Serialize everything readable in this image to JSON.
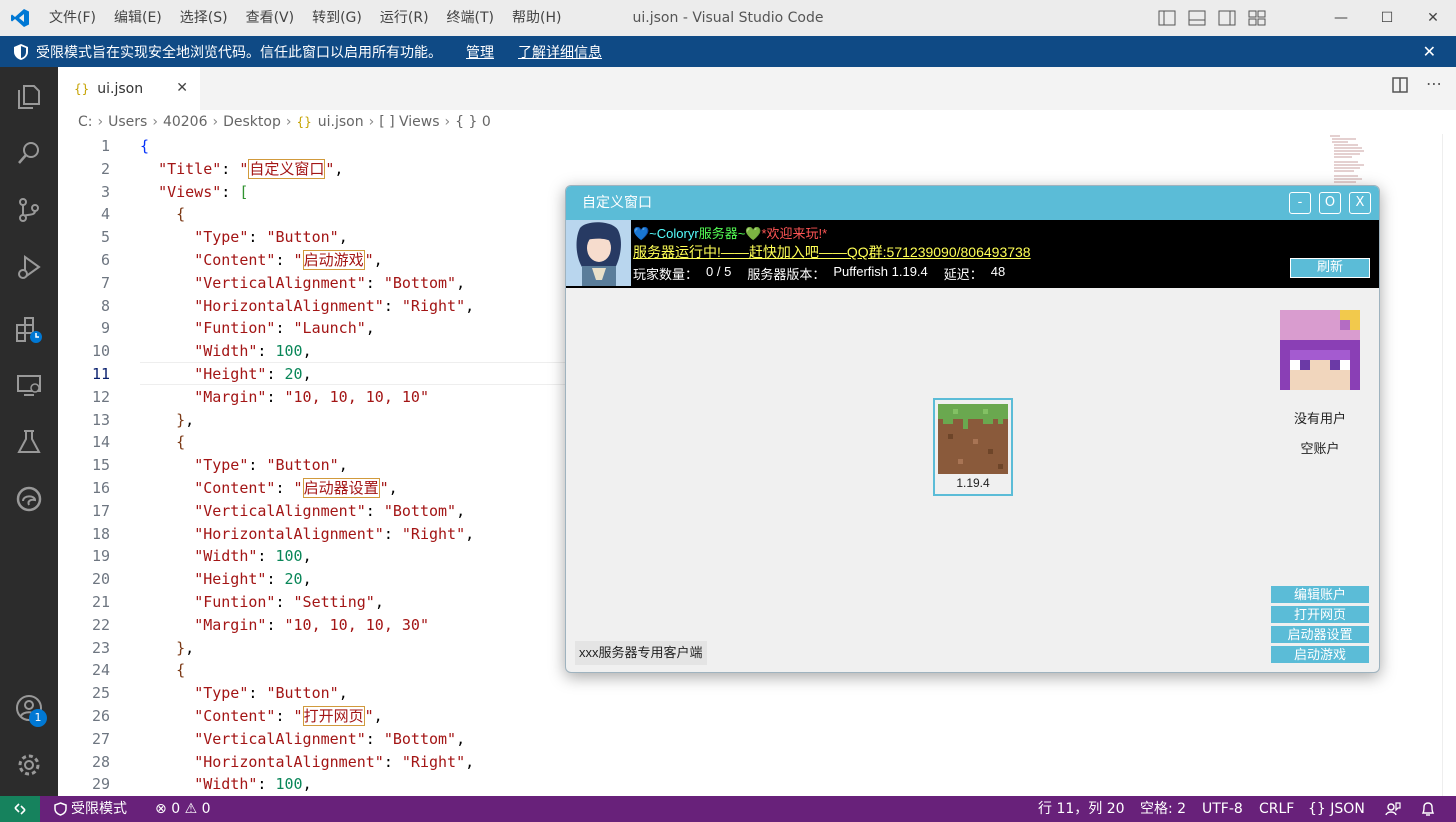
{
  "window": {
    "title": "ui.json - Visual Studio Code",
    "menu": [
      "文件(F)",
      "编辑(E)",
      "选择(S)",
      "查看(V)",
      "转到(G)",
      "运行(R)",
      "终端(T)",
      "帮助(H)"
    ]
  },
  "banner": {
    "text": "受限模式旨在实现安全地浏览代码。信任此窗口以启用所有功能。",
    "manage": "管理",
    "learn_more": "了解详细信息"
  },
  "activity": {
    "accounts_badge": "1"
  },
  "tab": {
    "label": "ui.json",
    "icon": "{}"
  },
  "breadcrumb": [
    "C:",
    "Users",
    "40206",
    "Desktop",
    "ui.json",
    "[ ] Views",
    "{ } 0"
  ],
  "editor": {
    "current_line": 11,
    "lines": [
      [
        {
          "t": "{",
          "c": "b1"
        }
      ],
      [
        {
          "t": "  "
        },
        {
          "t": "\"Title\"",
          "c": "k"
        },
        {
          "t": ": ",
          "c": "p"
        },
        {
          "t": "\"",
          "c": "s"
        },
        {
          "t": "自定义窗口",
          "c": "s hl"
        },
        {
          "t": "\"",
          "c": "s"
        },
        {
          "t": ",",
          "c": "p"
        }
      ],
      [
        {
          "t": "  "
        },
        {
          "t": "\"Views\"",
          "c": "k"
        },
        {
          "t": ": ",
          "c": "p"
        },
        {
          "t": "[",
          "c": "b2"
        }
      ],
      [
        {
          "t": "    "
        },
        {
          "t": "{",
          "c": "b3"
        }
      ],
      [
        {
          "t": "      "
        },
        {
          "t": "\"Type\"",
          "c": "k"
        },
        {
          "t": ": ",
          "c": "p"
        },
        {
          "t": "\"Button\"",
          "c": "s"
        },
        {
          "t": ",",
          "c": "p"
        }
      ],
      [
        {
          "t": "      "
        },
        {
          "t": "\"Content\"",
          "c": "k"
        },
        {
          "t": ": ",
          "c": "p"
        },
        {
          "t": "\"",
          "c": "s"
        },
        {
          "t": "启动游戏",
          "c": "s hl"
        },
        {
          "t": "\"",
          "c": "s"
        },
        {
          "t": ",",
          "c": "p"
        }
      ],
      [
        {
          "t": "      "
        },
        {
          "t": "\"VerticalAlignment\"",
          "c": "k"
        },
        {
          "t": ": ",
          "c": "p"
        },
        {
          "t": "\"Bottom\"",
          "c": "s"
        },
        {
          "t": ",",
          "c": "p"
        }
      ],
      [
        {
          "t": "      "
        },
        {
          "t": "\"HorizontalAlignment\"",
          "c": "k"
        },
        {
          "t": ": ",
          "c": "p"
        },
        {
          "t": "\"Right\"",
          "c": "s"
        },
        {
          "t": ",",
          "c": "p"
        }
      ],
      [
        {
          "t": "      "
        },
        {
          "t": "\"Funtion\"",
          "c": "k"
        },
        {
          "t": ": ",
          "c": "p"
        },
        {
          "t": "\"Launch\"",
          "c": "s"
        },
        {
          "t": ",",
          "c": "p"
        }
      ],
      [
        {
          "t": "      "
        },
        {
          "t": "\"Width\"",
          "c": "k"
        },
        {
          "t": ": ",
          "c": "p"
        },
        {
          "t": "100",
          "c": "n"
        },
        {
          "t": ",",
          "c": "p"
        }
      ],
      [
        {
          "t": "      "
        },
        {
          "t": "\"Height\"",
          "c": "k"
        },
        {
          "t": ": ",
          "c": "p"
        },
        {
          "t": "20",
          "c": "n"
        },
        {
          "t": ",",
          "c": "p"
        }
      ],
      [
        {
          "t": "      "
        },
        {
          "t": "\"Margin\"",
          "c": "k"
        },
        {
          "t": ": ",
          "c": "p"
        },
        {
          "t": "\"10, 10, 10, 10\"",
          "c": "s"
        }
      ],
      [
        {
          "t": "    "
        },
        {
          "t": "}",
          "c": "b3"
        },
        {
          "t": ",",
          "c": "p"
        }
      ],
      [
        {
          "t": "    "
        },
        {
          "t": "{",
          "c": "b3"
        }
      ],
      [
        {
          "t": "      "
        },
        {
          "t": "\"Type\"",
          "c": "k"
        },
        {
          "t": ": ",
          "c": "p"
        },
        {
          "t": "\"Button\"",
          "c": "s"
        },
        {
          "t": ",",
          "c": "p"
        }
      ],
      [
        {
          "t": "      "
        },
        {
          "t": "\"Content\"",
          "c": "k"
        },
        {
          "t": ": ",
          "c": "p"
        },
        {
          "t": "\"",
          "c": "s"
        },
        {
          "t": "启动器设置",
          "c": "s hl"
        },
        {
          "t": "\"",
          "c": "s"
        },
        {
          "t": ",",
          "c": "p"
        }
      ],
      [
        {
          "t": "      "
        },
        {
          "t": "\"VerticalAlignment\"",
          "c": "k"
        },
        {
          "t": ": ",
          "c": "p"
        },
        {
          "t": "\"Bottom\"",
          "c": "s"
        },
        {
          "t": ",",
          "c": "p"
        }
      ],
      [
        {
          "t": "      "
        },
        {
          "t": "\"HorizontalAlignment\"",
          "c": "k"
        },
        {
          "t": ": ",
          "c": "p"
        },
        {
          "t": "\"Right\"",
          "c": "s"
        },
        {
          "t": ",",
          "c": "p"
        }
      ],
      [
        {
          "t": "      "
        },
        {
          "t": "\"Width\"",
          "c": "k"
        },
        {
          "t": ": ",
          "c": "p"
        },
        {
          "t": "100",
          "c": "n"
        },
        {
          "t": ",",
          "c": "p"
        }
      ],
      [
        {
          "t": "      "
        },
        {
          "t": "\"Height\"",
          "c": "k"
        },
        {
          "t": ": ",
          "c": "p"
        },
        {
          "t": "20",
          "c": "n"
        },
        {
          "t": ",",
          "c": "p"
        }
      ],
      [
        {
          "t": "      "
        },
        {
          "t": "\"Funtion\"",
          "c": "k"
        },
        {
          "t": ": ",
          "c": "p"
        },
        {
          "t": "\"Setting\"",
          "c": "s"
        },
        {
          "t": ",",
          "c": "p"
        }
      ],
      [
        {
          "t": "      "
        },
        {
          "t": "\"Margin\"",
          "c": "k"
        },
        {
          "t": ": ",
          "c": "p"
        },
        {
          "t": "\"10, 10, 10, 30\"",
          "c": "s"
        }
      ],
      [
        {
          "t": "    "
        },
        {
          "t": "}",
          "c": "b3"
        },
        {
          "t": ",",
          "c": "p"
        }
      ],
      [
        {
          "t": "    "
        },
        {
          "t": "{",
          "c": "b3"
        }
      ],
      [
        {
          "t": "      "
        },
        {
          "t": "\"Type\"",
          "c": "k"
        },
        {
          "t": ": ",
          "c": "p"
        },
        {
          "t": "\"Button\"",
          "c": "s"
        },
        {
          "t": ",",
          "c": "p"
        }
      ],
      [
        {
          "t": "      "
        },
        {
          "t": "\"Content\"",
          "c": "k"
        },
        {
          "t": ": ",
          "c": "p"
        },
        {
          "t": "\"",
          "c": "s"
        },
        {
          "t": "打开网页",
          "c": "s hl"
        },
        {
          "t": "\"",
          "c": "s"
        },
        {
          "t": ",",
          "c": "p"
        }
      ],
      [
        {
          "t": "      "
        },
        {
          "t": "\"VerticalAlignment\"",
          "c": "k"
        },
        {
          "t": ": ",
          "c": "p"
        },
        {
          "t": "\"Bottom\"",
          "c": "s"
        },
        {
          "t": ",",
          "c": "p"
        }
      ],
      [
        {
          "t": "      "
        },
        {
          "t": "\"HorizontalAlignment\"",
          "c": "k"
        },
        {
          "t": ": ",
          "c": "p"
        },
        {
          "t": "\"Right\"",
          "c": "s"
        },
        {
          "t": ",",
          "c": "p"
        }
      ],
      [
        {
          "t": "      "
        },
        {
          "t": "\"Width\"",
          "c": "k"
        },
        {
          "t": ": ",
          "c": "p"
        },
        {
          "t": "100",
          "c": "n"
        },
        {
          "t": ",",
          "c": "p"
        }
      ]
    ]
  },
  "statusbar": {
    "restricted": "受限模式",
    "errors": "0",
    "warnings": "0",
    "position": "行 11，列 20",
    "spaces": "空格: 2",
    "encoding": "UTF-8",
    "eol": "CRLF",
    "language": "JSON",
    "language_icon": "{}"
  },
  "custom_window": {
    "title": "自定义窗口",
    "minimize": "-",
    "restore": "O",
    "close": "X",
    "motd_line1": [
      {
        "t": "💙~Coloryr",
        "color": "#55ffff"
      },
      {
        "t": "服务器~💚",
        "color": "#55ff55"
      },
      {
        "t": "*欢迎来玩!*",
        "color": "#ff5555"
      }
    ],
    "motd_line2": "服务器运行中!——赶快加入吧——QQ群:571239090/806493738",
    "players_label": "玩家数量：",
    "players_value": "0 / 5",
    "version_label": "服务器版本：",
    "version_value": "Pufferfish 1.19.4",
    "latency_label": "延迟：",
    "latency_value": "48",
    "refresh": "刷新",
    "user_name": "没有用户",
    "account": "空账户",
    "game_version": "1.19.4",
    "actions": [
      "编辑账户",
      "打开网页",
      "启动器设置",
      "启动游戏"
    ],
    "footer": "xxx服务器专用客户端"
  }
}
